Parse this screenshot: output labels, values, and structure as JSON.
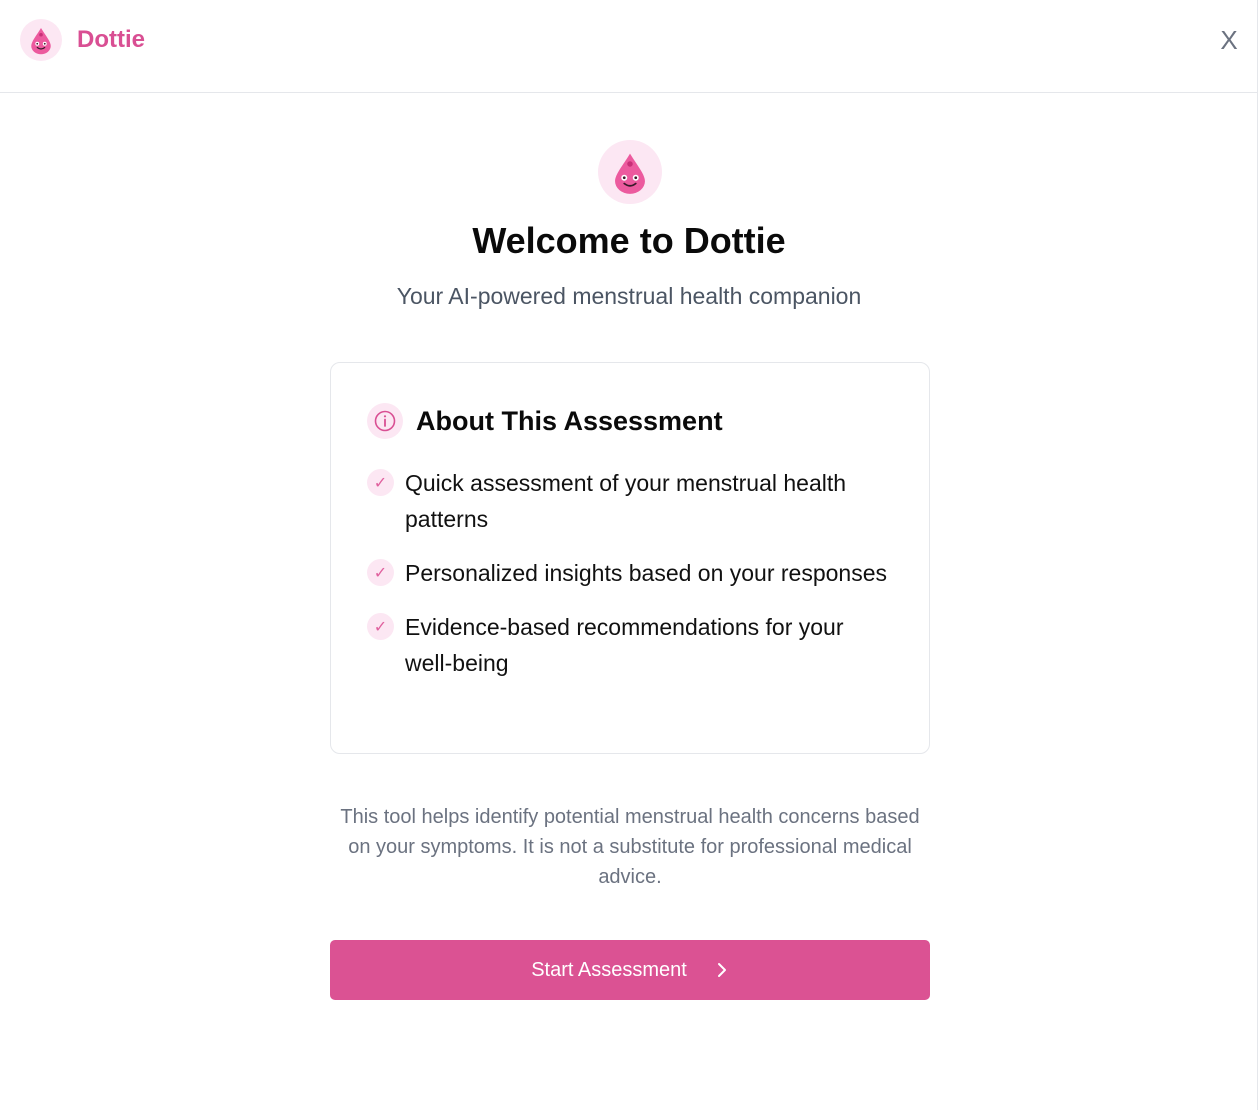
{
  "header": {
    "brand_name": "Dottie",
    "close_label": "X"
  },
  "hero": {
    "title": "Welcome to Dottie",
    "subtitle": "Your AI-powered menstrual health companion"
  },
  "about_card": {
    "title": "About This Assessment",
    "features": [
      "Quick assessment of your menstrual health patterns",
      "Personalized insights based on your responses",
      "Evidence-based recommendations for your well-being"
    ],
    "check_glyph": "✓"
  },
  "disclaimer": "This tool helps identify potential menstrual health concerns based on your symptoms. It is not a substitute for professional medical advice.",
  "cta": {
    "label": "Start Assessment"
  },
  "icons": {
    "logo": "dottie-drop-mascot-icon",
    "info": "info-icon",
    "check": "check-icon",
    "chevron": "chevron-right-icon",
    "close": "close-icon"
  },
  "colors": {
    "brand": "#d94f93",
    "button": "#db5293",
    "icon_bg": "#fce7f3",
    "text_muted": "#6b7280"
  }
}
